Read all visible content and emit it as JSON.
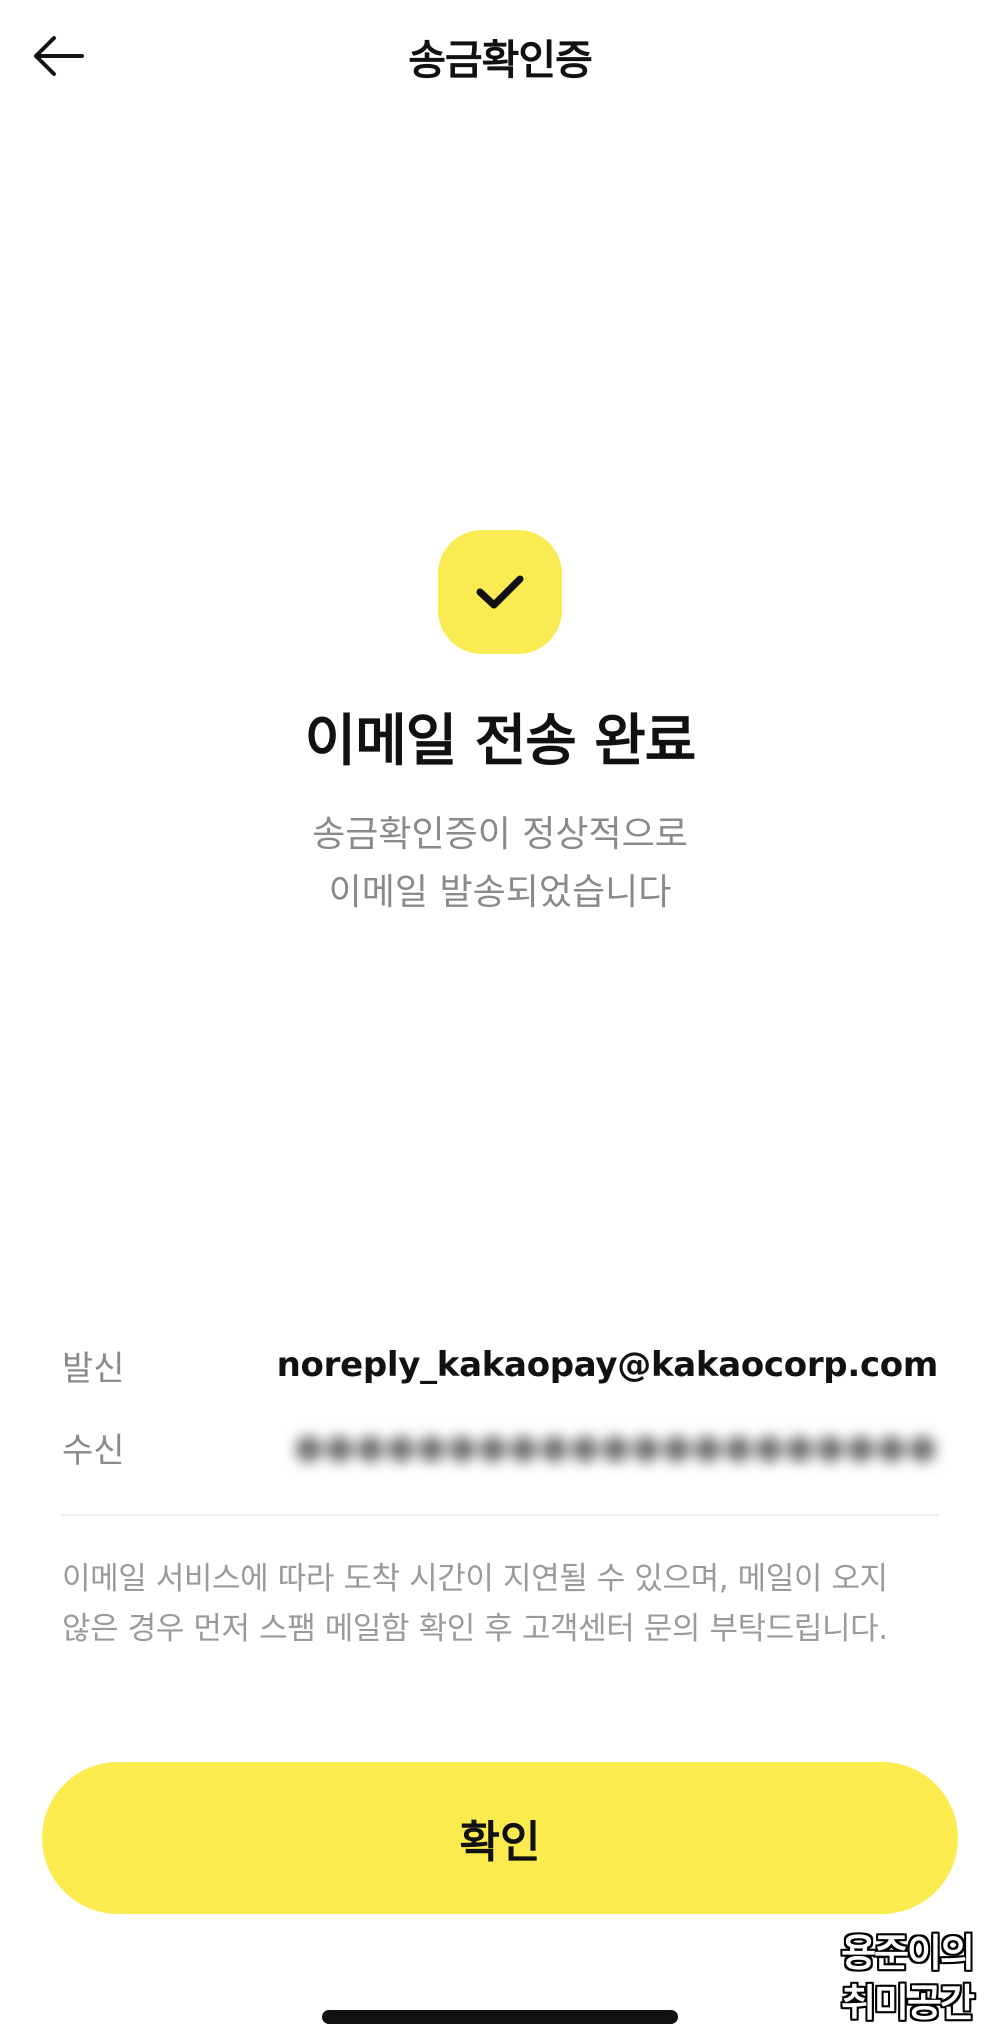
{
  "nav": {
    "title": "송금확인증",
    "back_icon": "arrow-left-icon"
  },
  "status": {
    "icon": "checkmark-icon",
    "badge_color": "#fbeb53",
    "headline": "이메일 전송 완료",
    "message_line1": "송금확인증이 정상적으로",
    "message_line2": "이메일 발송되었습니다"
  },
  "details": {
    "sender_label": "발신",
    "sender_value": "noreply_kakaopay@kakaocorp.com",
    "receiver_label": "수신",
    "receiver_value_redacted": "●●●●●●●●●●●●●●●●●●●●●"
  },
  "notice": {
    "line1": "이메일 서비스에 따라 도착 시간이 지연될 수 있으며, 메일이 오지",
    "line2": "않은 경우 먼저 스팸 메일함 확인 후 고객센터 문의 부탁드립니다."
  },
  "confirm_button": {
    "label": "확인",
    "color": "#fbeb4f"
  },
  "watermark": {
    "line1": "용준이의",
    "line2": "취미공간"
  }
}
